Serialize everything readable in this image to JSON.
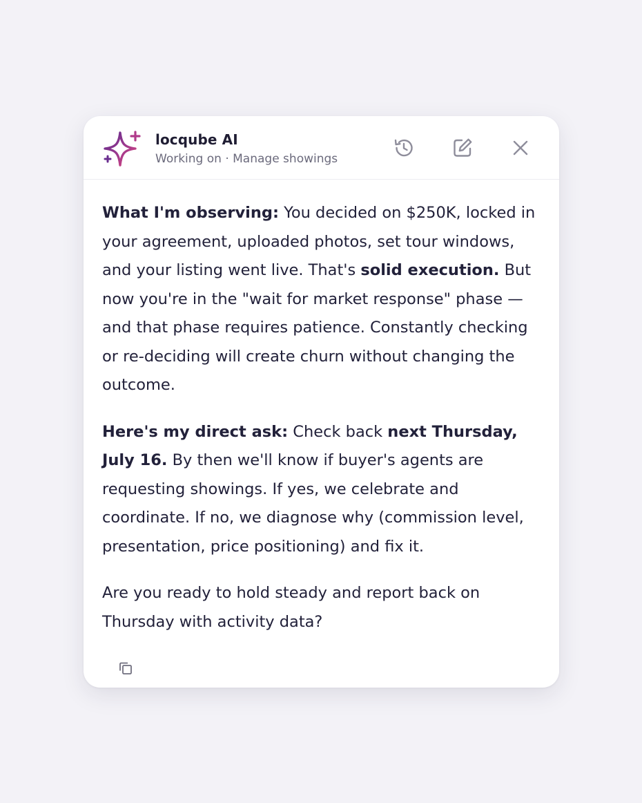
{
  "header": {
    "title": "locqube AI",
    "subtitle": "Working on · Manage showings",
    "icons": [
      "sparkle-logo-icon",
      "history-icon",
      "edit-icon",
      "close-icon"
    ]
  },
  "message": {
    "p1": {
      "b1": "What I'm observing:",
      "t1": " You decided on $250K, locked in your agreement, uploaded photos, set tour windows, and your listing went live. That's ",
      "b2": "solid execution.",
      "t2": " But now you're in the \"wait for market response\" phase — and that phase requires patience. Constantly checking or re-deciding will create churn without changing the outcome."
    },
    "p2": {
      "b1": "Here's my direct ask:",
      "t1": " Check back ",
      "b2": "next Thursday, July 16.",
      "t2": " By then we'll know if buyer's agents are requesting showings. If yes, we celebrate and coordinate. If no, we diagnose why (commission level, presentation, price positioning) and fix it."
    },
    "p3": {
      "t1": "Are you ready to hold steady and report back on Thursday with activity data?"
    }
  },
  "footer": {
    "copy_icon": "copy-icon"
  },
  "colors": {
    "background": "#f3f2f7",
    "panel": "#ffffff",
    "text": "#22213a",
    "muted": "#6b6a7c",
    "logo_start": "#5a2a8c",
    "logo_end": "#e0457b"
  }
}
